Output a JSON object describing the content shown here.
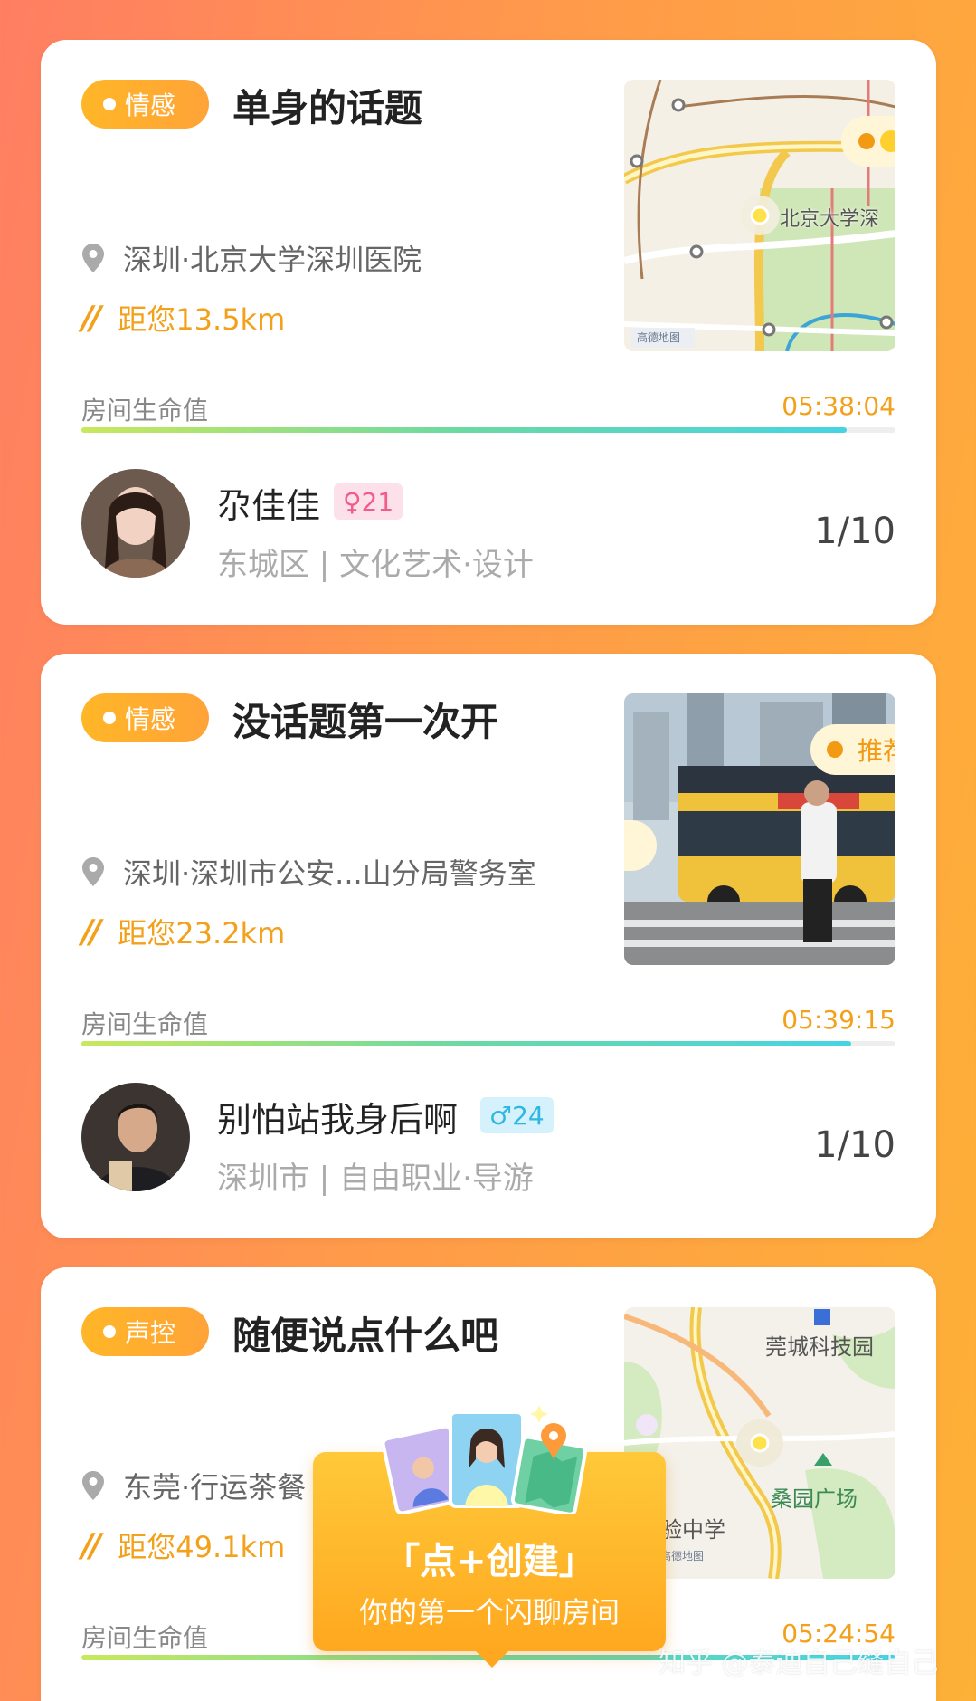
{
  "cards": [
    {
      "tag": "情感",
      "title": "单身的话题",
      "location": "深圳·北京大学深圳医院",
      "distance": "距您13.5km",
      "life_label": "房间生命值",
      "life_time": "05:38:04",
      "life_progress": 0.94,
      "user_name": "尕佳佳",
      "gender_badge": "♀21",
      "user_sub": "东城区 | 文化艺术·设计",
      "count": "1/10",
      "thumb_type": "map",
      "map_label": "北京大学深",
      "map_logo": "高德地图"
    },
    {
      "tag": "情感",
      "title": "没话题第一次开",
      "location": "深圳·深圳市公安...山分局警务室",
      "distance": "距您23.2km",
      "life_label": "房间生命值",
      "life_time": "05:39:15",
      "life_progress": 0.945,
      "user_name": "别怕站我身后啊",
      "gender_badge": "♂24",
      "user_sub": "深圳市 | 自由职业·导游",
      "count": "1/10",
      "thumb_type": "photo",
      "photo_pill": "推荐"
    },
    {
      "tag": "声控",
      "title": "随便说点什么吧",
      "location": "东莞·行运茶餐",
      "distance": "距您49.1km",
      "life_label": "房间生命值",
      "life_time": "05:24:54",
      "thumb_type": "map",
      "map_label_1": "莞城科技园",
      "map_label_2": "桑园广场",
      "map_label_3": "验中学",
      "map_logo": "高德地图"
    }
  ],
  "popup": {
    "title": "「点+创建」",
    "subtitle": "你的第一个闪聊房间"
  },
  "watermark": "知乎 @泰迪自己缝自己",
  "colors": {
    "accent": "#f3a01a",
    "tag": "#ffb627",
    "female": "#f25c8a",
    "male": "#2fb7e4"
  }
}
